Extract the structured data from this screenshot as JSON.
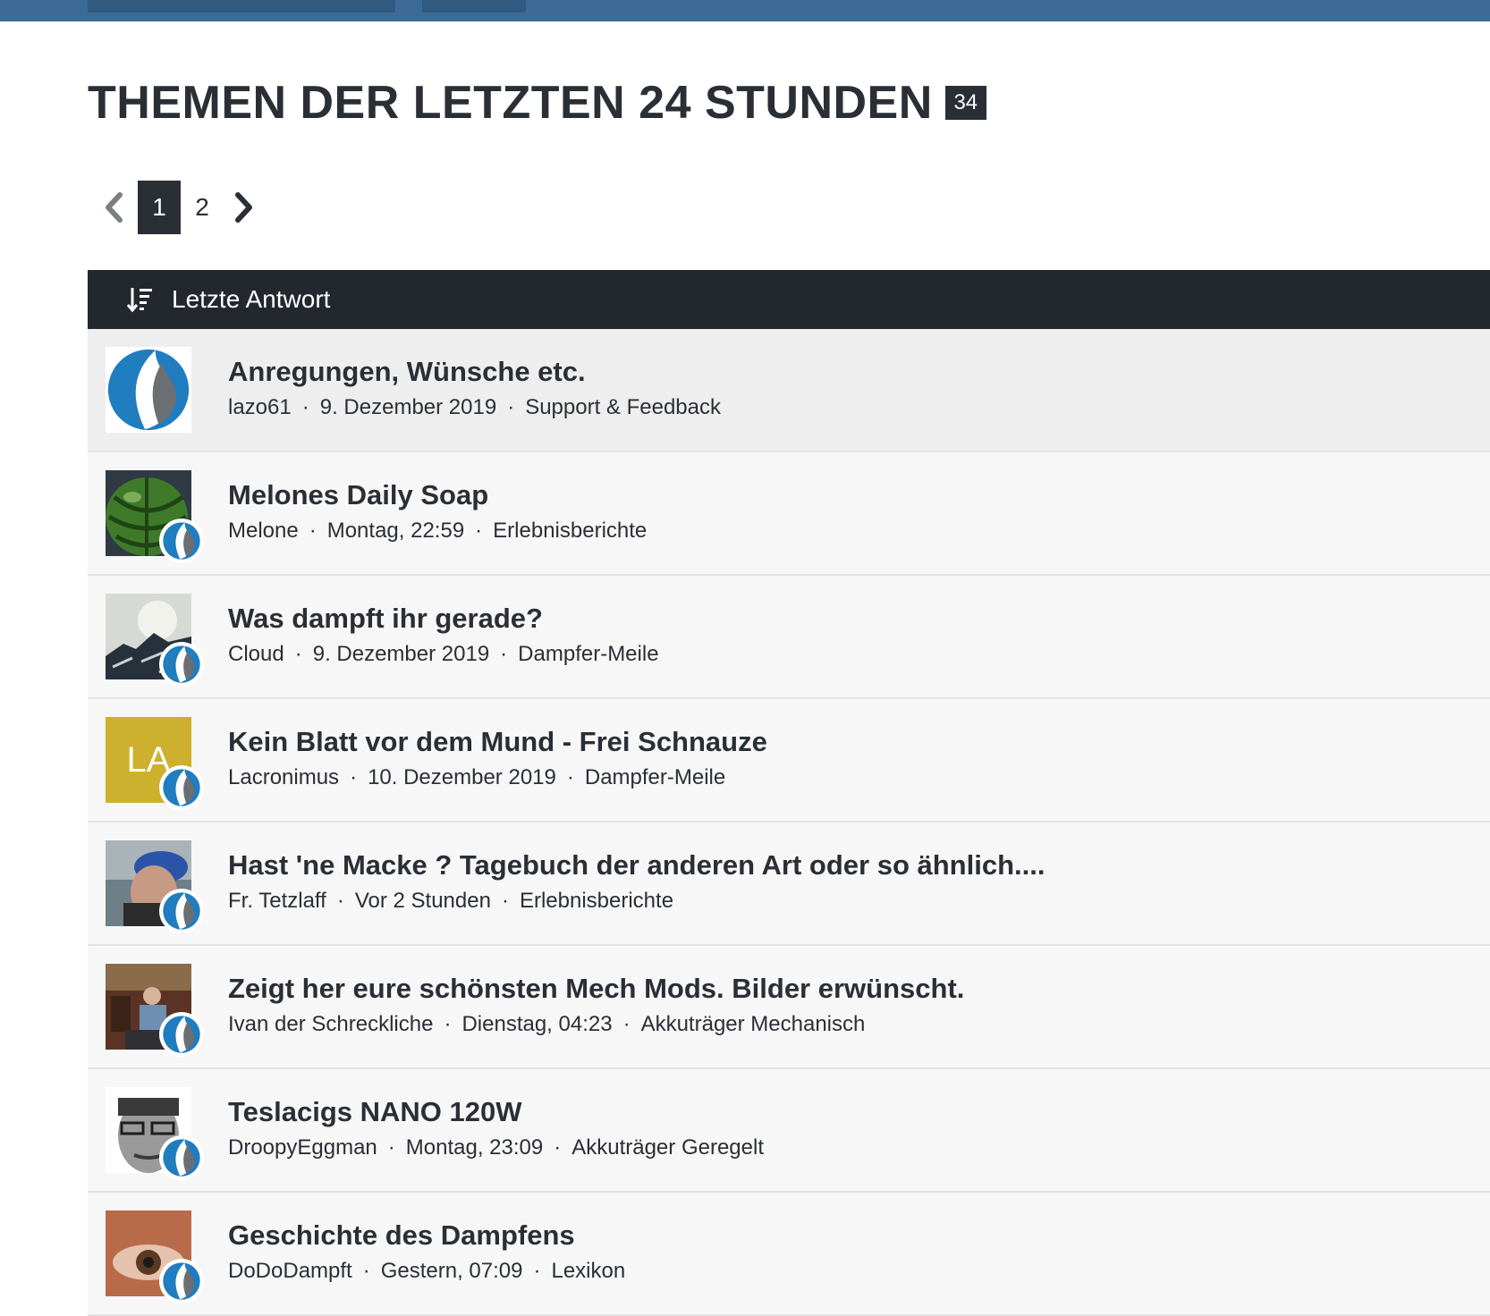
{
  "page": {
    "title": "THEMEN DER LETZTEN 24 STUNDEN",
    "count": "34"
  },
  "pagination": {
    "pages": [
      "1",
      "2"
    ],
    "active": "1"
  },
  "list": {
    "sort_label": "Letzte Antwort",
    "topics": [
      {
        "title": "Anregungen, Wünsche etc.",
        "author": "lazo61",
        "time": "9. Dezember 2019",
        "forum": "Support & Feedback",
        "avatar": "logo"
      },
      {
        "title": "Melones Daily Soap",
        "author": "Melone",
        "time": "Montag, 22:59",
        "forum": "Erlebnisberichte",
        "avatar": "melon"
      },
      {
        "title": "Was dampft ihr gerade?",
        "author": "Cloud",
        "time": "9. Dezember 2019",
        "forum": "Dampfer-Meile",
        "avatar": "mountain"
      },
      {
        "title": "Kein Blatt vor dem Mund - Frei Schnauze",
        "author": "Lacronimus",
        "time": "10. Dezember 2019",
        "forum": "Dampfer-Meile",
        "avatar": "initials",
        "initials": "LA"
      },
      {
        "title": "Hast 'ne Macke ? Tagebuch der anderen Art oder so ähnlich....",
        "author": "Fr. Tetzlaff",
        "time": "Vor 2 Stunden",
        "forum": "Erlebnisberichte",
        "avatar": "photo-sea"
      },
      {
        "title": "Zeigt her eure schönsten Mech Mods. Bilder erwünscht.",
        "author": "Ivan der Schreckliche",
        "time": "Dienstag, 04:23",
        "forum": "Akkuträger Mechanisch",
        "avatar": "photo-room"
      },
      {
        "title": "Teslacigs NANO 120W",
        "author": "DroopyEggman",
        "time": "Montag, 23:09",
        "forum": "Akkuträger Geregelt",
        "avatar": "photo-face"
      },
      {
        "title": "Geschichte des Dampfens",
        "author": "DoDoDampft",
        "time": "Gestern, 07:09",
        "forum": "Lexikon",
        "avatar": "photo-eye"
      }
    ]
  },
  "colors": {
    "topbar": "#3d6b98",
    "header": "#23282e",
    "logo_blue": "#1f7dc0",
    "logo_gray": "#6b6e72",
    "initials_bg": "#cdb02e"
  }
}
